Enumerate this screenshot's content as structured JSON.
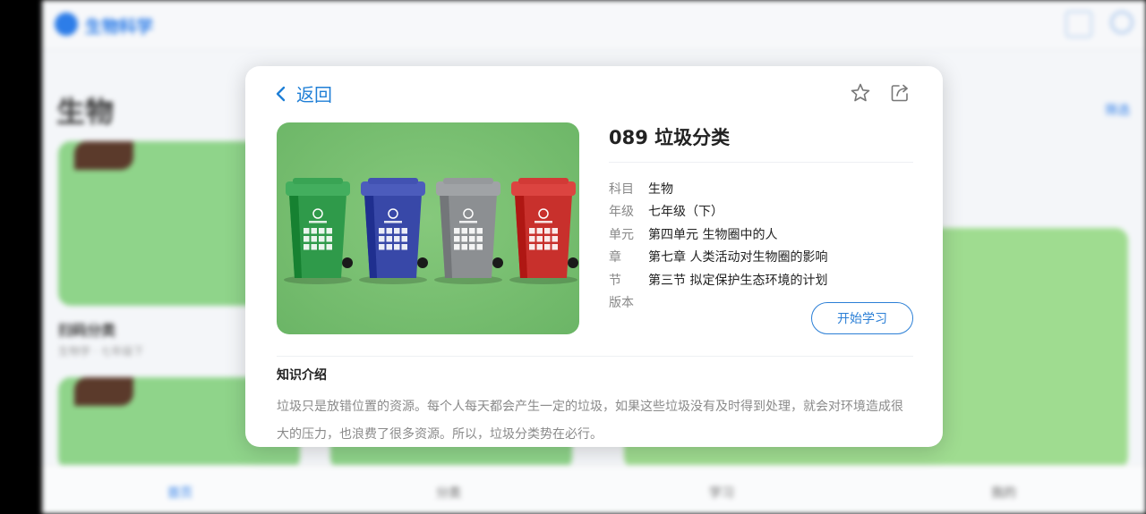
{
  "background": {
    "app_name": "生物科学",
    "page_title": "生物",
    "filter_label": "筛选",
    "card_title": "扫码分类",
    "card_subtitle": "生物学 · 七年级下",
    "tabs": [
      "首页",
      "分类",
      "学习",
      "我的"
    ]
  },
  "modal": {
    "back_label": "返回",
    "title": "089 垃圾分类",
    "meta": [
      {
        "key": "科目",
        "value": "生物"
      },
      {
        "key": "年级",
        "value": "七年级（下）"
      },
      {
        "key": "单元",
        "value": "第四单元 生物圈中的人"
      },
      {
        "key": "章",
        "value": "第七章 人类活动对生物圈的影响"
      },
      {
        "key": "节",
        "value": "第三节 拟定保护生态环境的计划"
      },
      {
        "key": "版本",
        "value": ""
      }
    ],
    "start_button": "开始学习",
    "section_title": "知识介绍",
    "intro_text": "垃圾只是放错位置的资源。每个人每天都会产生一定的垃圾，如果这些垃圾没有及时得到处理，就会对环境造成很大的压力，也浪费了很多资源。所以，垃圾分类势在必行。",
    "icons": {
      "back": "chevron-left-icon",
      "favorite": "star-icon",
      "share": "share-icon"
    },
    "colors": {
      "accent": "#1f7fd6",
      "bin_green": "#2f9a4a",
      "bin_blue": "#3848a8",
      "bin_gray": "#8c8f92",
      "bin_red": "#c8302c"
    }
  }
}
